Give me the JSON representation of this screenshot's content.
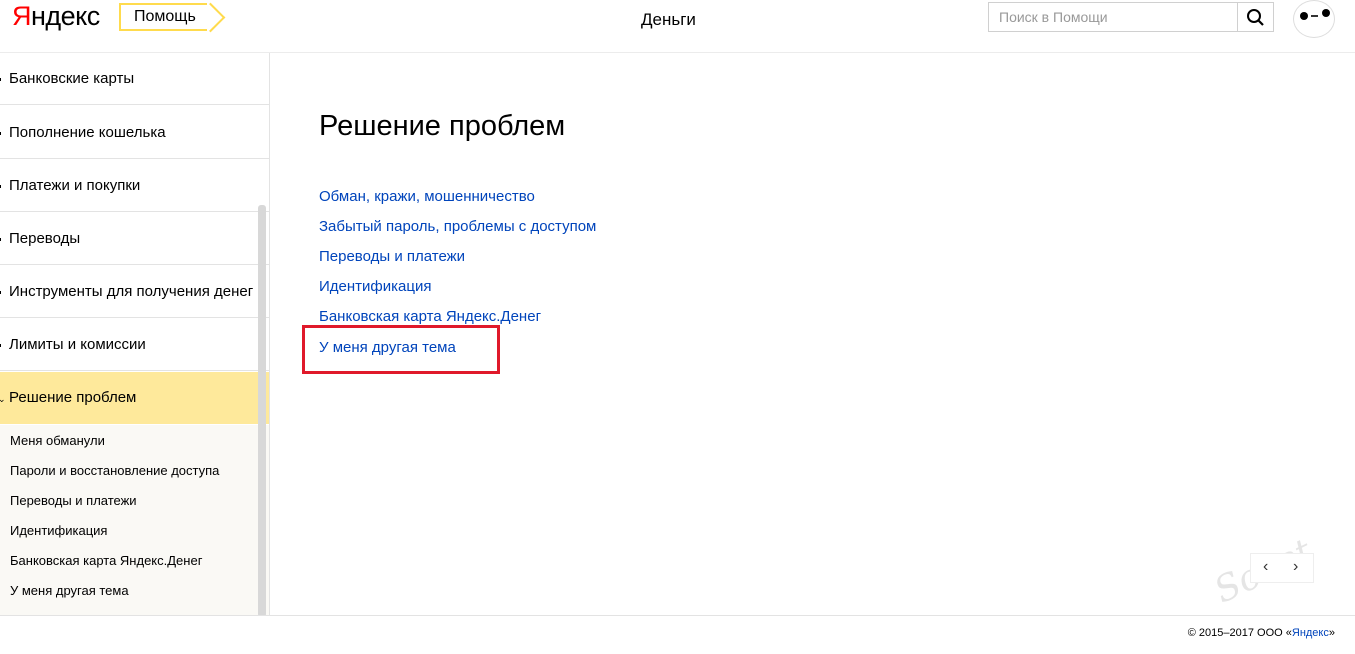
{
  "header": {
    "logo_first": "Я",
    "logo_rest": "ндекс",
    "help_tag": "Помощь",
    "service_title": "Деньги",
    "search_placeholder": "Поиск в Помощи"
  },
  "sidebar": {
    "items": [
      {
        "label": "Банковские карты"
      },
      {
        "label": "Пополнение кошелька"
      },
      {
        "label": "Платежи и покупки"
      },
      {
        "label": "Переводы"
      },
      {
        "label": "Инструменты для получения денег"
      },
      {
        "label": "Лимиты и комиссии"
      },
      {
        "label": "Решение проблем",
        "active": true
      }
    ],
    "sub_items": [
      {
        "label": "Меня обманули"
      },
      {
        "label": "Пароли и восстановление доступа"
      },
      {
        "label": "Переводы и платежи"
      },
      {
        "label": "Идентификация"
      },
      {
        "label": "Банковская карта Яндекс.Денег"
      },
      {
        "label": "У меня другая тема"
      }
    ]
  },
  "main": {
    "title": "Решение проблем",
    "links": [
      {
        "label": "Обман, кражи, мошенничество"
      },
      {
        "label": "Забытый пароль, проблемы с доступом"
      },
      {
        "label": "Переводы и платежи"
      },
      {
        "label": "Идентификация"
      },
      {
        "label": "Банковская карта Яндекс.Денег"
      },
      {
        "label": "У меня другая тема"
      }
    ]
  },
  "pager": {
    "prev": "‹",
    "next": "›"
  },
  "watermark": "Sovet",
  "footer": {
    "copyright_prefix": "© 2015–2017  ООО «",
    "copyright_link": "Яндекс",
    "copyright_suffix": "»"
  },
  "colors": {
    "link": "#0044bb",
    "active_bg": "#fee99b",
    "highlight": "#e0192a",
    "accent": "#ffdb4d"
  }
}
